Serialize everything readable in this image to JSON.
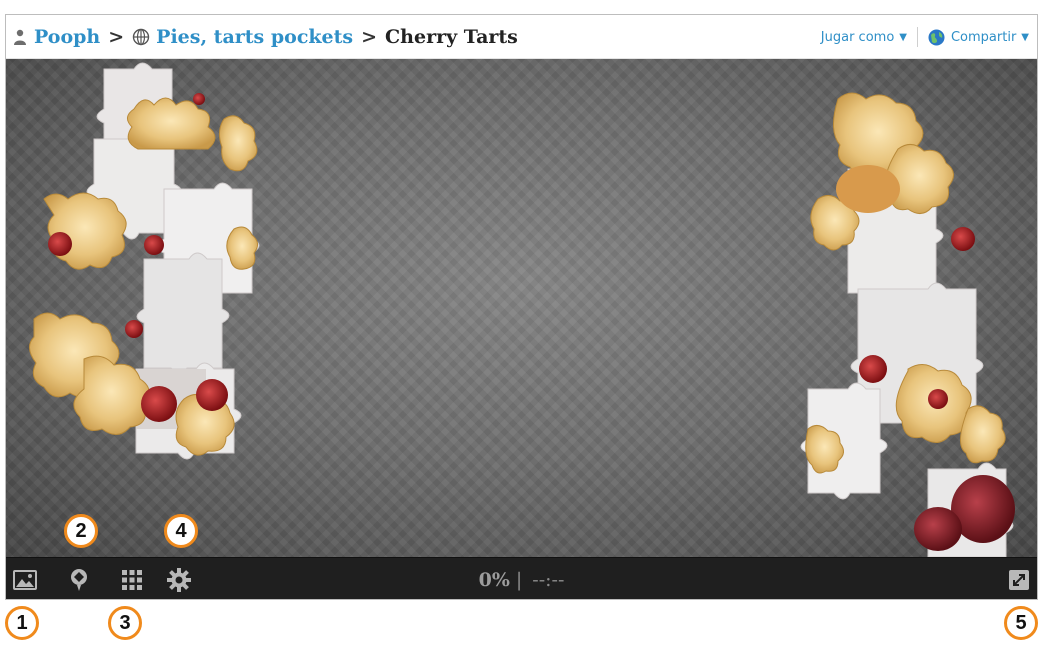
{
  "header": {
    "user": "Pooph",
    "separator": ">",
    "category": "Pies, tarts pockets",
    "puzzle_title": "Cherry Tarts",
    "play_as_label": "Jugar como",
    "share_label": "Compartir"
  },
  "toolbar": {
    "progress_percent": "0%",
    "divider": "|",
    "timer": "--:--"
  },
  "callouts": [
    "1",
    "2",
    "3",
    "4",
    "5"
  ],
  "colors": {
    "link_blue": "#2f8fc7",
    "callout_orange": "#f08a1c",
    "toolbar_bg": "#1f1f1f"
  },
  "icons": {
    "user": "user-icon",
    "category": "globe-grid-icon",
    "share": "globe-icon",
    "preview": "image-icon",
    "ghost": "balloon-icon",
    "arrange": "grid-icon",
    "settings": "gear-icon",
    "fullscreen": "fullscreen-icon"
  }
}
